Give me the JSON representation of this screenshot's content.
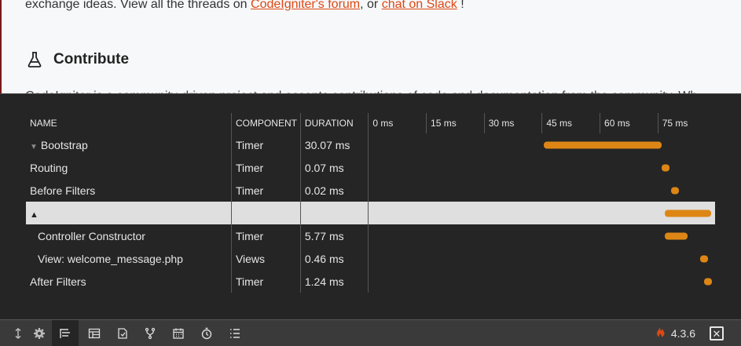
{
  "background": {
    "intro_prefix": "exchange ideas. View all the threads on ",
    "forum_link": "CodeIgniter's forum",
    "intro_mid": ", or ",
    "slack_link": "chat on Slack",
    "intro_suffix": " !",
    "section_title": "Contribute",
    "clipped_text": "CodeIgniter is a community-driven project and accepts contributions of code and documentation from the community. Wh"
  },
  "timeline": {
    "headers": {
      "name": "NAME",
      "component": "COMPONENT",
      "duration": "DURATION",
      "ticks": [
        "0 ms",
        "15 ms",
        "30 ms",
        "45 ms",
        "60 ms",
        "75 ms"
      ]
    },
    "rows": [
      {
        "name": "Bootstrap",
        "component": "Timer",
        "duration": "30.07 ms",
        "toggle": "▼",
        "start_ms": 44.5,
        "dur_ms": 30.07
      },
      {
        "name": "Routing",
        "component": "Timer",
        "duration": "0.07 ms",
        "start_ms": 74.6,
        "dur_ms": 0.07
      },
      {
        "name": "Before Filters",
        "component": "Timer",
        "duration": "0.02 ms",
        "start_ms": 76.9,
        "dur_ms": 0.02
      },
      {
        "name": "",
        "component": "",
        "duration": "",
        "toggle": "▲",
        "start_ms": 75.3,
        "dur_ms": 11.9
      },
      {
        "name": "Controller Constructor",
        "component": "Timer",
        "duration": "5.77 ms",
        "start_ms": 75.3,
        "dur_ms": 5.77
      },
      {
        "name": "View: welcome_message.php",
        "component": "Views",
        "duration": "0.46 ms",
        "start_ms": 84.3,
        "dur_ms": 0.46
      },
      {
        "name": "After Filters",
        "component": "Timer",
        "duration": "1.24 ms",
        "start_ms": 85.4,
        "dur_ms": 1.24
      }
    ]
  },
  "toolbar": {
    "icons": [
      "resize-icon",
      "settings-icon",
      "timeline-icon",
      "database-icon",
      "files-icon",
      "routes-icon",
      "events-icon",
      "history-icon",
      "logs-icon"
    ],
    "version": "4.3.6"
  },
  "colors": {
    "bar": "#dd8615",
    "accent_link": "#dd4814",
    "panel_bg": "#252525"
  }
}
